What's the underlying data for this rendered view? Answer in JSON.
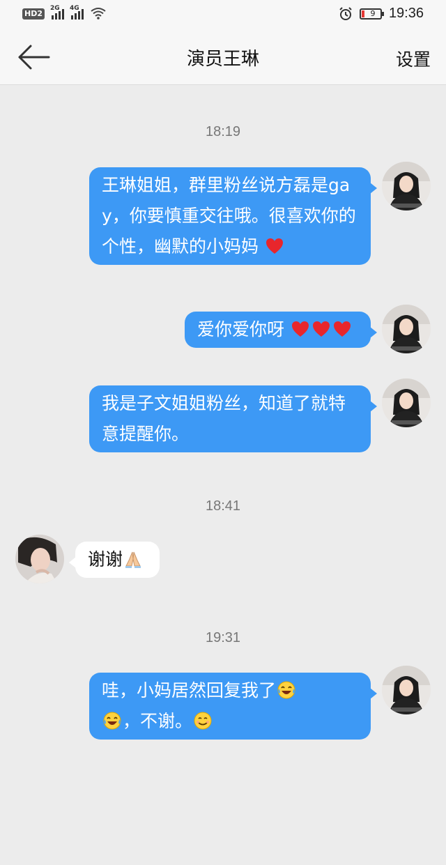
{
  "status_bar": {
    "hd_label": "HD2",
    "network_1": "2G",
    "network_2": "4G",
    "battery_level": "9",
    "clock": "19:36"
  },
  "nav": {
    "title": "演员王琳",
    "settings_label": "设置"
  },
  "messages": {
    "ts1": "18:19",
    "m1_text": "王琳姐姐，群里粉丝说方磊是gay，你要慎重交往哦。很喜欢你的个性，幽默的小妈妈",
    "m2_text": "爱你爱你呀",
    "m3_text": "我是子文姐姐粉丝，知道了就特意提醒你。",
    "ts2": "18:41",
    "m4_text": "谢谢",
    "ts3": "19:31",
    "m5_text_a": "哇，小妈居然回复我了",
    "m5_text_b": "，不谢。"
  },
  "icons": {
    "back": "arrow-left-icon",
    "heart": "red-heart-emoji",
    "pray": "folded-hands-emoji",
    "laugh": "tears-of-joy-emoji",
    "smile": "smiling-face-emoji"
  },
  "colors": {
    "outgoing_bubble": "#3d99f5",
    "incoming_bubble": "#ffffff",
    "background": "#ececec"
  }
}
